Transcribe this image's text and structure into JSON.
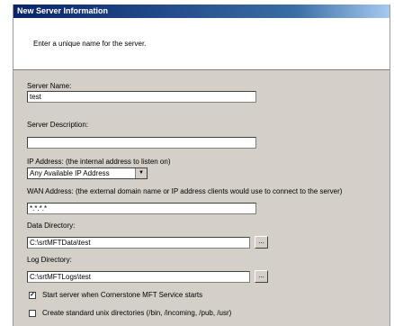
{
  "window": {
    "title": "New Server Information"
  },
  "header": {
    "text": "Enter a unique name for the server."
  },
  "server_name": {
    "label": "Server Name:",
    "value": "test"
  },
  "server_description": {
    "label": "Server Description:",
    "value": ""
  },
  "ip_address": {
    "label": "IP Address: (the internal address to listen on)",
    "selected": "Any Available IP Address",
    "dropdown_icon": "chevron-down-icon"
  },
  "wan_address": {
    "label": "WAN Address: (the external domain name or IP address clients would use to connect to the server)",
    "value": "*.*.*.*"
  },
  "data_directory": {
    "label": "Data Directory:",
    "value": "C:\\srtMFTData\\test",
    "browse_label": "..."
  },
  "log_directory": {
    "label": "Log Directory:",
    "value": "C:\\srtMFTLogs\\test",
    "browse_label": "..."
  },
  "options": [
    {
      "label": "Start server when Cornerstone MFT Service starts",
      "checked": true,
      "mark": "✓"
    },
    {
      "label": "Create standard unix directories (/bin, /incoming, /pub, /usr)",
      "checked": false,
      "mark": ""
    }
  ]
}
